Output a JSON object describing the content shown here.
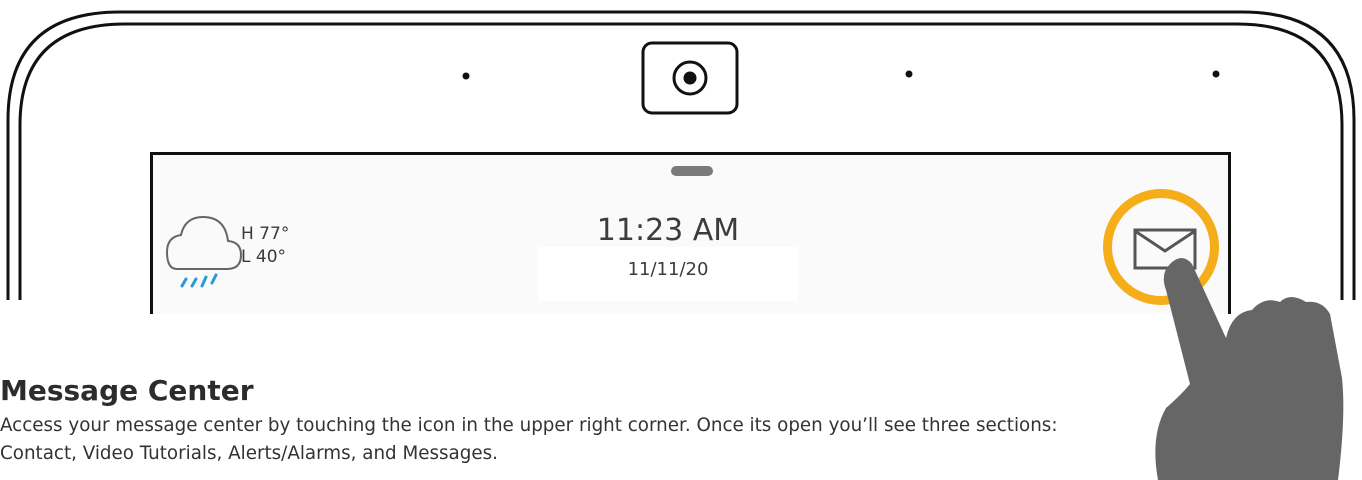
{
  "weather": {
    "high": "H 77°",
    "low": "L 40°",
    "icon": "rain-cloud-icon"
  },
  "clock": {
    "time": "11:23 AM",
    "date": "11/11/20"
  },
  "message_center": {
    "icon": "envelope-icon",
    "highlight_color": "#f6ad1a"
  },
  "hand_icon": "pointing-hand-icon",
  "help": {
    "title": "Message Center",
    "body": "Access your message center by touching the icon in the upper right corner.  Once its open you’ll see three sections: Contact, Video Tutorials, Alerts/Alarms, and Messages."
  }
}
